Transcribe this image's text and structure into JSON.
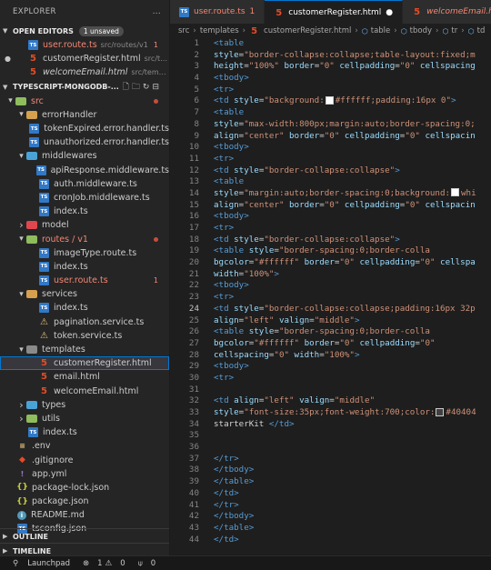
{
  "sidebar": {
    "title": "EXPLORER",
    "more_icon": "...",
    "open_editors": {
      "label": "OPEN EDITORS",
      "badge": "1 unsaved",
      "items": [
        {
          "icon": "ts",
          "label": "user.route.ts",
          "desc": "src/routes/v1",
          "count": "1",
          "red": true,
          "dot": false
        },
        {
          "icon": "html",
          "label": "customerRegister.html",
          "desc": "src/tem...",
          "count": "",
          "red": false,
          "dot": true
        },
        {
          "icon": "html",
          "label": "welcomeEmail.html",
          "desc": "src/templates",
          "count": "",
          "red": false,
          "dot": false,
          "italic": true
        }
      ]
    },
    "project": {
      "label": "TYPESCRIPT-MONGODB-...",
      "tree": [
        {
          "d": 0,
          "type": "folder",
          "label": "src",
          "open": true,
          "color": "#8fbc5c",
          "dot": true,
          "labelRed": true
        },
        {
          "d": 1,
          "type": "folder",
          "label": "errorHandler",
          "open": true,
          "color": "#d6a04f"
        },
        {
          "d": 2,
          "type": "ts",
          "label": "tokenExpired.error.handler.ts"
        },
        {
          "d": 2,
          "type": "ts",
          "label": "unauthorized.error.handler.ts"
        },
        {
          "d": 1,
          "type": "folder",
          "label": "middlewares",
          "open": true,
          "color": "#4aa3d6"
        },
        {
          "d": 2,
          "type": "ts",
          "label": "apiResponse.middleware.ts"
        },
        {
          "d": 2,
          "type": "ts",
          "label": "auth.middleware.ts"
        },
        {
          "d": 2,
          "type": "ts",
          "label": "cronJob.middleware.ts"
        },
        {
          "d": 2,
          "type": "ts",
          "label": "index.ts"
        },
        {
          "d": 1,
          "type": "folder",
          "label": "model",
          "open": false,
          "color": "#e0464e"
        },
        {
          "d": 1,
          "type": "folder",
          "label": "routes / v1",
          "open": true,
          "color": "#8fbc5c",
          "dot": true,
          "labelRed": true
        },
        {
          "d": 2,
          "type": "ts",
          "label": "imageType.route.ts"
        },
        {
          "d": 2,
          "type": "ts",
          "label": "index.ts"
        },
        {
          "d": 2,
          "type": "ts",
          "label": "user.route.ts",
          "count": "1",
          "labelRed": true
        },
        {
          "d": 1,
          "type": "folder",
          "label": "services",
          "open": true,
          "color": "#d6a04f"
        },
        {
          "d": 2,
          "type": "ts",
          "label": "index.ts"
        },
        {
          "d": 2,
          "type": "warn",
          "label": "pagination.service.ts"
        },
        {
          "d": 2,
          "type": "warn",
          "label": "token.service.ts"
        },
        {
          "d": 1,
          "type": "folder",
          "label": "templates",
          "open": true,
          "color": "#8a8a8a"
        },
        {
          "d": 2,
          "type": "html",
          "label": "customerRegister.html",
          "selected": true
        },
        {
          "d": 2,
          "type": "html",
          "label": "email.html"
        },
        {
          "d": 2,
          "type": "html",
          "label": "welcomeEmail.html"
        },
        {
          "d": 1,
          "type": "folder",
          "label": "types",
          "open": false,
          "color": "#4aa3d6"
        },
        {
          "d": 1,
          "type": "folder",
          "label": "utils",
          "open": false,
          "color": "#8fbc5c"
        },
        {
          "d": 1,
          "type": "ts",
          "label": "index.ts"
        },
        {
          "d": 0,
          "type": "env",
          "label": ".env"
        },
        {
          "d": 0,
          "type": "git",
          "label": ".gitignore"
        },
        {
          "d": 0,
          "type": "yml",
          "label": "app.yml"
        },
        {
          "d": 0,
          "type": "json",
          "label": "package-lock.json"
        },
        {
          "d": 0,
          "type": "json",
          "label": "package.json"
        },
        {
          "d": 0,
          "type": "info",
          "label": "README.md"
        },
        {
          "d": 0,
          "type": "ts",
          "label": "tsconfig.json"
        }
      ]
    },
    "outline_label": "OUTLINE",
    "timeline_label": "TIMELINE"
  },
  "tabs": [
    {
      "icon": "ts",
      "label": "user.route.ts",
      "suffix": "1",
      "red": true,
      "active": false
    },
    {
      "icon": "html",
      "label": "customerRegister.html",
      "suffix": "●",
      "red": false,
      "active": true
    },
    {
      "icon": "html",
      "label": "welcomeEmail.html",
      "suffix": "",
      "red": true,
      "active": false,
      "italic": true
    }
  ],
  "breadcrumb": [
    "src",
    "templates",
    "customerRegister.html",
    "table",
    "tbody",
    "tr",
    "td"
  ],
  "editor": {
    "current_line": 24,
    "lines": [
      [
        [
          "tag",
          "<table"
        ]
      ],
      [
        [
          "attr",
          "style"
        ],
        [
          "txt",
          "="
        ],
        [
          "str",
          "\"border-collapse:collapse;table-layout:fixed;m"
        ]
      ],
      [
        [
          "attr",
          "height"
        ],
        [
          "txt",
          "="
        ],
        [
          "str",
          "\"100%\" "
        ],
        [
          "attr",
          "border"
        ],
        [
          "txt",
          "="
        ],
        [
          "str",
          "\"0\" "
        ],
        [
          "attr",
          "cellpadding"
        ],
        [
          "txt",
          "="
        ],
        [
          "str",
          "\"0\" "
        ],
        [
          "attr",
          "cellspacing"
        ]
      ],
      [
        [
          "tag",
          "<tbody>"
        ]
      ],
      [
        [
          "tag",
          "<tr>"
        ]
      ],
      [
        [
          "tag",
          "<td "
        ],
        [
          "attr",
          "style"
        ],
        [
          "txt",
          "="
        ],
        [
          "str",
          "\"background:"
        ],
        [
          "swatch",
          "white"
        ],
        [
          "str",
          "#ffffff;padding:16px 0\""
        ],
        [
          "tag",
          ">"
        ]
      ],
      [
        [
          "tag",
          "<table"
        ]
      ],
      [
        [
          "attr",
          "style"
        ],
        [
          "txt",
          "="
        ],
        [
          "str",
          "\"max-width:800px;margin:auto;border-spacing:0;"
        ]
      ],
      [
        [
          "attr",
          "align"
        ],
        [
          "txt",
          "="
        ],
        [
          "str",
          "\"center\" "
        ],
        [
          "attr",
          "border"
        ],
        [
          "txt",
          "="
        ],
        [
          "str",
          "\"0\" "
        ],
        [
          "attr",
          "cellpadding"
        ],
        [
          "txt",
          "="
        ],
        [
          "str",
          "\"0\" "
        ],
        [
          "attr",
          "cellspacin"
        ]
      ],
      [
        [
          "tag",
          "<tbody>"
        ]
      ],
      [
        [
          "tag",
          "<tr>"
        ]
      ],
      [
        [
          "tag",
          "<td "
        ],
        [
          "attr",
          "style"
        ],
        [
          "txt",
          "="
        ],
        [
          "str",
          "\"border-collapse:collapse\""
        ],
        [
          "tag",
          ">"
        ]
      ],
      [
        [
          "tag",
          "<table"
        ]
      ],
      [
        [
          "attr",
          "style"
        ],
        [
          "txt",
          "="
        ],
        [
          "str",
          "\"margin:auto;border-spacing:0;background:"
        ],
        [
          "swatch",
          "white"
        ],
        [
          "str",
          "whi"
        ]
      ],
      [
        [
          "attr",
          "align"
        ],
        [
          "txt",
          "="
        ],
        [
          "str",
          "\"center\" "
        ],
        [
          "attr",
          "border"
        ],
        [
          "txt",
          "="
        ],
        [
          "str",
          "\"0\" "
        ],
        [
          "attr",
          "cellpadding"
        ],
        [
          "txt",
          "="
        ],
        [
          "str",
          "\"0\" "
        ],
        [
          "attr",
          "cellspacin"
        ]
      ],
      [
        [
          "tag",
          "<tbody>"
        ]
      ],
      [
        [
          "tag",
          "<tr>"
        ]
      ],
      [
        [
          "tag",
          "<td "
        ],
        [
          "attr",
          "style"
        ],
        [
          "txt",
          "="
        ],
        [
          "str",
          "\"border-collapse:collapse\""
        ],
        [
          "tag",
          ">"
        ]
      ],
      [
        [
          "tag",
          "<table "
        ],
        [
          "attr",
          "style"
        ],
        [
          "txt",
          "="
        ],
        [
          "str",
          "\"border-spacing:0;border-colla"
        ]
      ],
      [
        [
          "attr",
          "bgcolor"
        ],
        [
          "txt",
          "="
        ],
        [
          "str",
          "\"#ffffff\" "
        ],
        [
          "attr",
          "border"
        ],
        [
          "txt",
          "="
        ],
        [
          "str",
          "\"0\" "
        ],
        [
          "attr",
          "cellpadding"
        ],
        [
          "txt",
          "="
        ],
        [
          "str",
          "\"0\" "
        ],
        [
          "attr",
          "cellspa"
        ]
      ],
      [
        [
          "attr",
          "width"
        ],
        [
          "txt",
          "="
        ],
        [
          "str",
          "\"100%\""
        ],
        [
          "tag",
          ">"
        ]
      ],
      [
        [
          "tag",
          "<tbody>"
        ]
      ],
      [
        [
          "tag",
          "<tr>"
        ]
      ],
      [
        [
          "tag",
          "<td "
        ],
        [
          "attr",
          "style"
        ],
        [
          "txt",
          "="
        ],
        [
          "str",
          "\"border-collapse:collapse;padding:16px 32p"
        ]
      ],
      [
        [
          "attr",
          "align"
        ],
        [
          "txt",
          "="
        ],
        [
          "str",
          "\"left\" "
        ],
        [
          "attr",
          "valign"
        ],
        [
          "txt",
          "="
        ],
        [
          "str",
          "\"middle\""
        ],
        [
          "tag",
          ">"
        ]
      ],
      [
        [
          "tag",
          "<table "
        ],
        [
          "attr",
          "style"
        ],
        [
          "txt",
          "="
        ],
        [
          "str",
          "\"border-spacing:0;border-colla"
        ]
      ],
      [
        [
          "attr",
          "bgcolor"
        ],
        [
          "txt",
          "="
        ],
        [
          "str",
          "\"#ffffff\" "
        ],
        [
          "attr",
          "border"
        ],
        [
          "txt",
          "="
        ],
        [
          "str",
          "\"0\" "
        ],
        [
          "attr",
          "cellpadding"
        ],
        [
          "txt",
          "="
        ],
        [
          "str",
          "\"0\""
        ]
      ],
      [
        [
          "attr",
          "cellspacing"
        ],
        [
          "txt",
          "="
        ],
        [
          "str",
          "\"0\" "
        ],
        [
          "attr",
          "width"
        ],
        [
          "txt",
          "="
        ],
        [
          "str",
          "\"100%\""
        ],
        [
          "tag",
          ">"
        ]
      ],
      [
        [
          "tag",
          "<tbody>"
        ]
      ],
      [
        [
          "tag",
          "<tr>"
        ]
      ],
      [],
      [
        [
          "tag",
          "<td "
        ],
        [
          "attr",
          "align"
        ],
        [
          "txt",
          "="
        ],
        [
          "str",
          "\"left\" "
        ],
        [
          "attr",
          "valign"
        ],
        [
          "txt",
          "="
        ],
        [
          "str",
          "\"middle\""
        ]
      ],
      [
        [
          "attr",
          "style"
        ],
        [
          "txt",
          "="
        ],
        [
          "str",
          "\"font-size:35px;font-weight:700;color:"
        ],
        [
          "swatch",
          "dark"
        ],
        [
          "str",
          "#40404"
        ]
      ],
      [
        [
          "txt",
          "starterKit "
        ],
        [
          "tag",
          "</td>"
        ]
      ],
      [],
      [],
      [
        [
          "tag",
          "</tr>"
        ]
      ],
      [
        [
          "tag",
          "</tbody>"
        ]
      ],
      [
        [
          "tag",
          "</table>"
        ]
      ],
      [
        [
          "tag",
          "</td>"
        ]
      ],
      [
        [
          "tag",
          "</tr>"
        ]
      ],
      [
        [
          "tag",
          "</tbody>"
        ]
      ],
      [
        [
          "tag",
          "</table>"
        ]
      ],
      [
        [
          "tag",
          "</td>"
        ]
      ]
    ]
  },
  "statusbar": {
    "launchpad": "Launchpad",
    "errors": "1",
    "warnings": "0",
    "ports": "0"
  },
  "colors": {
    "accent": "#0078d4",
    "tag": "#569cd6",
    "attr": "#9cdcfe",
    "string": "#ce9178",
    "error": "#f48771"
  }
}
